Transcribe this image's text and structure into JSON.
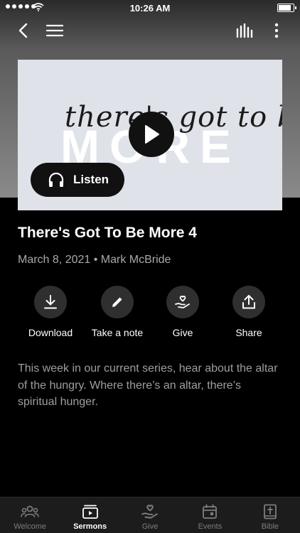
{
  "status_bar": {
    "time": "10:26 AM"
  },
  "artwork": {
    "script_text": "there's got to be",
    "big_text": "MORE"
  },
  "listen_label": "Listen",
  "sermon": {
    "title": "There's Got To Be More 4",
    "meta": "March 8, 2021 • Mark McBride",
    "description": "This week in our current series, hear about the altar of the hungry. Where there’s an altar, there’s spiritual hunger."
  },
  "actions": [
    {
      "label": "Download",
      "icon": "download-icon"
    },
    {
      "label": "Take a note",
      "icon": "pencil-icon"
    },
    {
      "label": "Give",
      "icon": "give-heart-icon"
    },
    {
      "label": "Share",
      "icon": "share-icon"
    }
  ],
  "tabs": [
    {
      "label": "Welcome",
      "icon": "people-icon"
    },
    {
      "label": "Sermons",
      "icon": "sermons-icon",
      "active": true
    },
    {
      "label": "Give",
      "icon": "give-heart-icon"
    },
    {
      "label": "Events",
      "icon": "calendar-icon"
    },
    {
      "label": "Bible",
      "icon": "bible-icon"
    }
  ],
  "colors": {
    "background": "#000000",
    "tab_bar": "#1c1c1c",
    "action_circle": "#2f2f2f",
    "muted_text": "#a9a9a9"
  }
}
